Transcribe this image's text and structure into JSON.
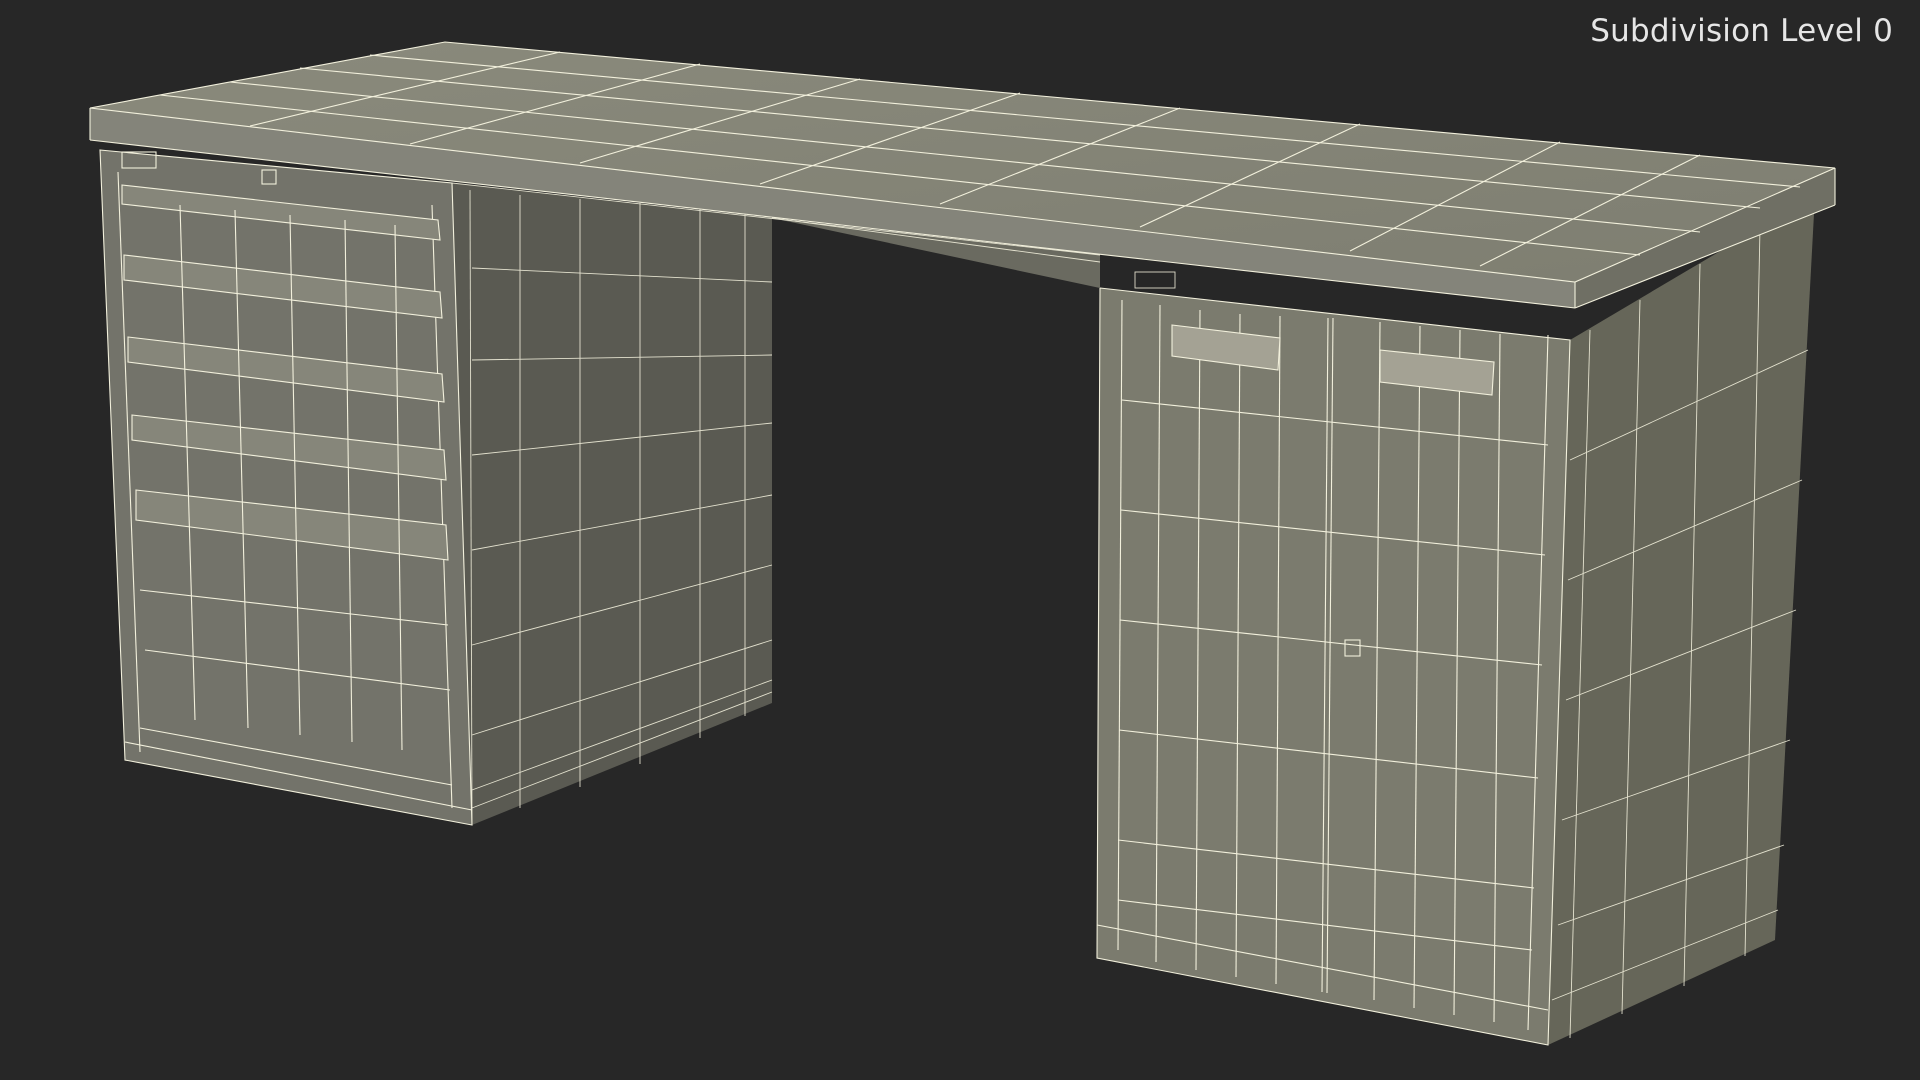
{
  "viewport": {
    "overlay_label": "Subdivision Level 0",
    "background_color": "#272727",
    "wire_color": "#f2f0dc",
    "surface_color": "#7b7b6e"
  },
  "model": {
    "subject": "desk-wireframe",
    "parts": [
      "desktop",
      "left-drawer-pedestal",
      "right-door-cabinet"
    ]
  }
}
